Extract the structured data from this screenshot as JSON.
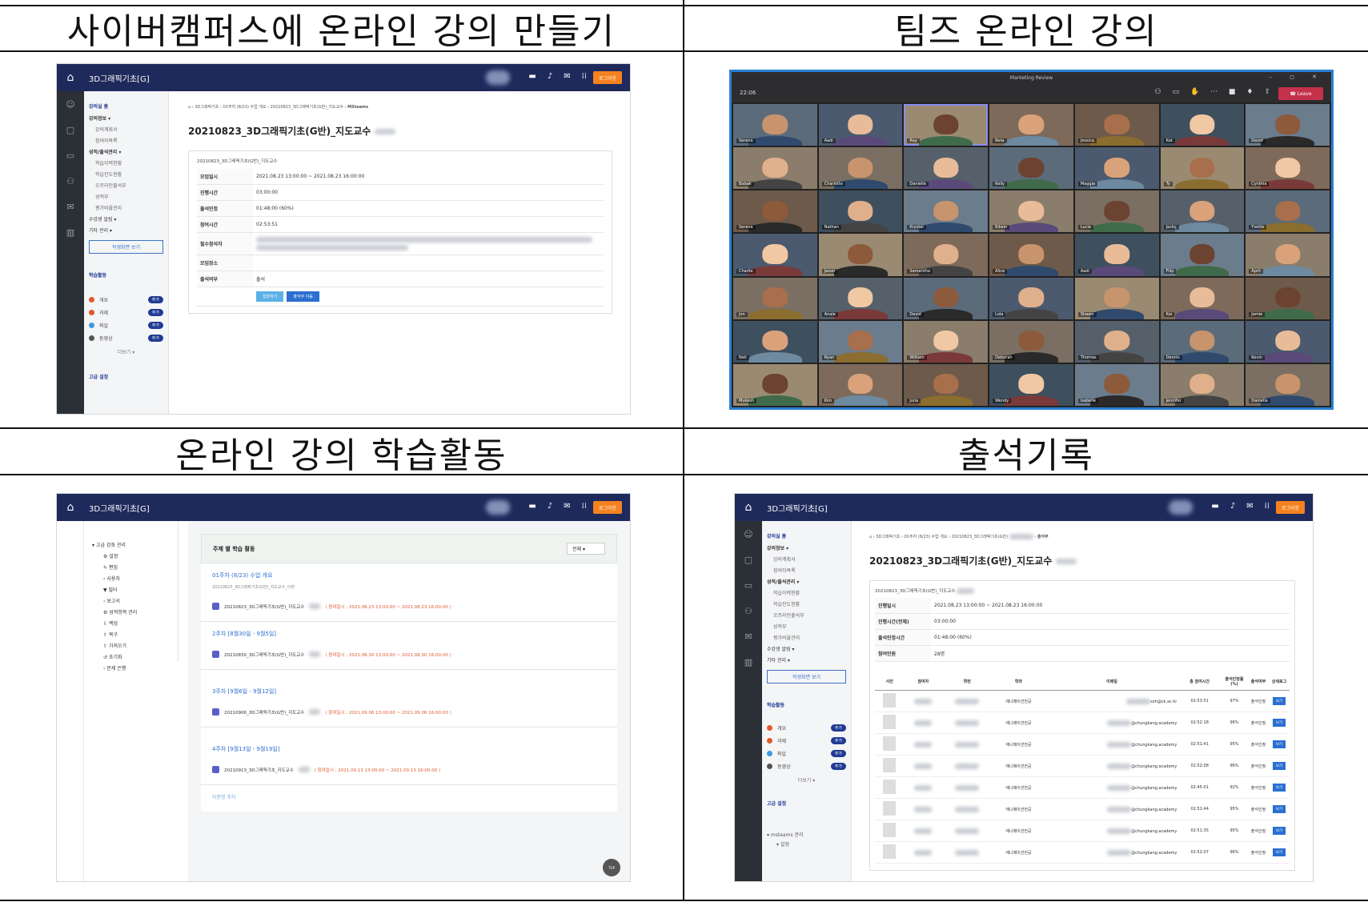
{
  "titles": {
    "top_left": "사이버캠퍼스에 온라인 강의 만들기",
    "top_right": "팀즈 온라인 강의",
    "bottom_left": "온라인 강의 학습활동",
    "bottom_right": "출석기록"
  },
  "lms_course": {
    "course_name": "3D그래픽기초[G]",
    "logout": "로그아웃",
    "side_home": "강의실 홈",
    "side_items": [
      "강의정보 ▾",
      "강의계획서",
      "참여자목록",
      "성적/출석관리 ▾",
      "학습이력현황",
      "학습진도현황",
      "오프라인출석부",
      "성적부",
      "평가비율관리",
      "수강생 알림 ▾",
      "기타 관리 ▾"
    ],
    "student_view_btn": "학생화면 보기",
    "activity_header": "학습활동",
    "activities": [
      {
        "label": "개요",
        "color": "#e05a2b",
        "add": "추가"
      },
      {
        "label": "과제",
        "color": "#e05a2b",
        "add": "추가"
      },
      {
        "label": "파일",
        "color": "#3b9ae1",
        "add": "추가"
      },
      {
        "label": "동영상",
        "color": "#555555",
        "add": "추가"
      }
    ],
    "more": "더보기 ▾",
    "advanced": "고급 설정"
  },
  "panel1": {
    "breadcrumb": [
      "3D그래픽기초",
      "01주차 (8/23) 수업 개요",
      "20210823_3D그래픽기초(G반)_지도교수",
      "MSteams"
    ],
    "page_title": "20210823_3D그래픽기초(G반)_지도교수",
    "card_title": "20210823_3D그래픽기초(G반)_지도교수",
    "rows": [
      {
        "k": "모임일시",
        "v": "2021.08.23 13:00:00 ~ 2021.08.23 16:00:00"
      },
      {
        "k": "진행시간",
        "v": "03:00:00"
      },
      {
        "k": "출석인정",
        "v": "01:48:00 (60%)"
      },
      {
        "k": "참여시간",
        "v": "02:53:51"
      },
      {
        "k": "필수참석자",
        "v": ""
      },
      {
        "k": "모임장소",
        "v": ""
      },
      {
        "k": "출석여부",
        "v": "출석"
      }
    ],
    "btn_join": "입장하기",
    "btn_attendance": "출석부 이동"
  },
  "teams": {
    "meeting_title": "Marketing Review",
    "time": "22:06",
    "leave": "Leave",
    "participants": [
      "Serena",
      "Aadi",
      "Ray",
      "Reta",
      "Jessica",
      "Kat",
      "David",
      "Babak",
      "Charlotte",
      "Danielle",
      "Kelly",
      "Maggie",
      "Ty",
      "Cynthia",
      "Serena",
      "Nathan",
      "Krystal",
      "Edwin",
      "Lucia",
      "Jacky",
      "Yvette",
      "Charlie",
      "Jason",
      "Samantha",
      "Alice",
      "Aadi",
      "Filip",
      "April",
      "Jon",
      "Anaie",
      "David",
      "Lola",
      "Shawn",
      "Kai",
      "Jamie",
      "Neil",
      "Ryan",
      "William",
      "Deborah",
      "Thomas",
      "Dennis",
      "Kevin",
      "Mukesh",
      "Kim",
      "Julia",
      "Wendy",
      "Isabelle",
      "Jennifer",
      "Daniella"
    ]
  },
  "panel3": {
    "side_tree": [
      "고급 강좌 관리",
      "설정",
      "편집",
      "사용자",
      "필터",
      "보고서",
      "성적항목 관리",
      "백업",
      "복구",
      "가져오기",
      "초기화",
      "문제 은행"
    ],
    "header": "주제 별 학습 활동",
    "filter": "전체",
    "weeks": [
      {
        "title": "01주차 (8/23) 수업 개요",
        "sub": "20210823_3D그래픽기초(G반)_지도교수_이현",
        "item": "20210823_3D그래픽기초(G반)_지도교수",
        "date": "( 참여일시 : 2021.08.23 13:00:00 ~ 2021.08.23 16:00:00 )"
      },
      {
        "title": "2주차 [8월30일 - 9월5일]",
        "sub": "",
        "item": "20210830_3D그래픽기초(G반)_지도교수",
        "date": "( 참여일시 : 2021.08.30 13:00:00 ~ 2021.08.30 16:00:00 )"
      },
      {
        "title": "3주차 [9월6일 - 9월12일]",
        "sub": "",
        "item": "20210906_3D그래픽기초(G반)_지도교수",
        "date": "( 참여일시 : 2021.09.06 13:00:00 ~ 2021.09.06 16:00:00 )"
      },
      {
        "title": "4주차 [9월13일 - 9월19일]",
        "sub": "",
        "item": "20210913_3D그래픽기초_지도교수",
        "date": "( 참여일시 : 2021.09.13 13:00:00 ~ 2021.09.13 16:00:00 )"
      }
    ],
    "unassigned": "미분명 주차",
    "top": "TOP"
  },
  "panel4": {
    "breadcrumb": [
      "3D그래픽기초",
      "01주차 (8/23) 수업 개요",
      "20210823_3D그래픽기초(G반)",
      "출석부"
    ],
    "page_title": "20210823_3D그래픽기초(G반)_지도교수",
    "card_title": "20210823_3D그래픽기초(G반)_지도교수",
    "rows": [
      {
        "k": "진행일시",
        "v": "2021.08.23 13:00:00 ~ 2021.08.23 16:00:00"
      },
      {
        "k": "진행시간(전체)",
        "v": "03:00:00"
      },
      {
        "k": "출석인정시간",
        "v": "01:48:00 (60%)"
      },
      {
        "k": "참여인원",
        "v": "28명"
      }
    ],
    "columns": [
      "사진",
      "참여자",
      "학번",
      "학과",
      "이메일",
      "총 참여시간",
      "출석인정률 (%)",
      "출석여부",
      "상세로그"
    ],
    "records": [
      {
        "dept": "애니메이션전공",
        "email": "soh@ck.ac.kr",
        "time": "02:53:51",
        "rate": "97%",
        "status": "출석인정",
        "view": "보기"
      },
      {
        "dept": "애니메이션전공",
        "email": "@chungkang.academy",
        "time": "02:52:18",
        "rate": "96%",
        "status": "출석인정",
        "view": "보기"
      },
      {
        "dept": "애니메이션전공",
        "email": "@chungkang.academy",
        "time": "02:51:41",
        "rate": "95%",
        "status": "출석인정",
        "view": "보기"
      },
      {
        "dept": "애니메이션전공",
        "email": "@chungkang.academy",
        "time": "02:52:08",
        "rate": "96%",
        "status": "출석인정",
        "view": "보기"
      },
      {
        "dept": "애니메이션전공",
        "email": "@chungkang.academy",
        "time": "02:45:01",
        "rate": "92%",
        "status": "출석인정",
        "view": "보기"
      },
      {
        "dept": "애니메이션전공",
        "email": "@chungkang.academy",
        "time": "02:51:44",
        "rate": "95%",
        "status": "출석인정",
        "view": "보기"
      },
      {
        "dept": "애니메이션전공",
        "email": "@chungkang.academy",
        "time": "02:51:35",
        "rate": "95%",
        "status": "출석인정",
        "view": "보기"
      },
      {
        "dept": "애니메이션전공",
        "email": "@chungkang.academy",
        "time": "02:52:07",
        "rate": "96%",
        "status": "출석인정",
        "view": "보기"
      }
    ],
    "msteams_mgmt": "msteams 관리",
    "msteams_setting": "설정"
  }
}
